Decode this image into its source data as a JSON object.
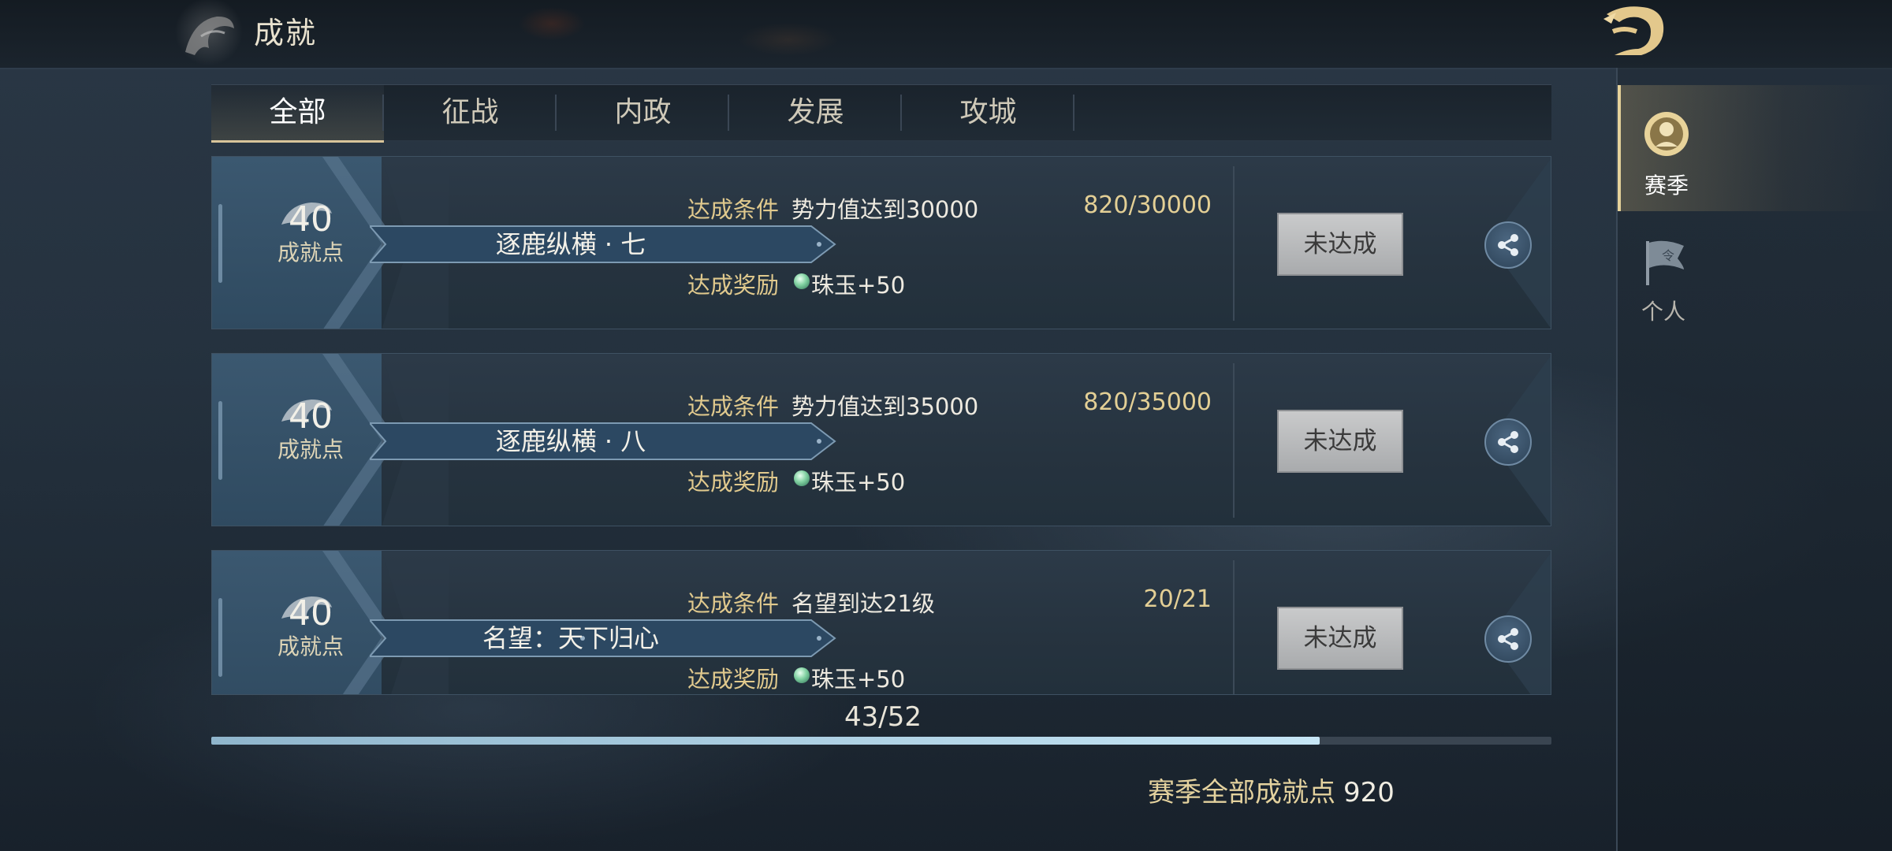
{
  "header": {
    "title": "成就"
  },
  "tabs": [
    {
      "label": "全部",
      "active": true
    },
    {
      "label": "征战",
      "active": false
    },
    {
      "label": "内政",
      "active": false
    },
    {
      "label": "发展",
      "active": false
    },
    {
      "label": "攻城",
      "active": false
    }
  ],
  "achievements": [
    {
      "points": "40",
      "points_label": "成就点",
      "name": "逐鹿纵横 · 七",
      "condition_label": "达成条件",
      "condition": "势力值达到30000",
      "progress": "820/30000",
      "reward_label": "达成奖励",
      "reward": "珠玉+50",
      "status": "未达成"
    },
    {
      "points": "40",
      "points_label": "成就点",
      "name": "逐鹿纵横 · 八",
      "condition_label": "达成条件",
      "condition": "势力值达到35000",
      "progress": "820/35000",
      "reward_label": "达成奖励",
      "reward": "珠玉+50",
      "status": "未达成"
    },
    {
      "points": "40",
      "points_label": "成就点",
      "name": "名望：天下归心",
      "condition_label": "达成条件",
      "condition": "名望到达21级",
      "progress": "20/21",
      "reward_label": "达成奖励",
      "reward": "珠玉+50",
      "status": "未达成"
    }
  ],
  "progress": {
    "count": "43/52",
    "fraction": 0.827
  },
  "season_total": {
    "label": "赛季全部成就点",
    "value": "920"
  },
  "sidebar": {
    "items": [
      {
        "label": "赛季",
        "icon": "season-badge-icon",
        "active": true
      },
      {
        "label": "个人",
        "icon": "flag-icon",
        "active": false
      }
    ]
  },
  "colors": {
    "accent_gold": "#e0c98d",
    "progress_fill": "#c6e6f6",
    "button_grey": "#b9babb"
  }
}
